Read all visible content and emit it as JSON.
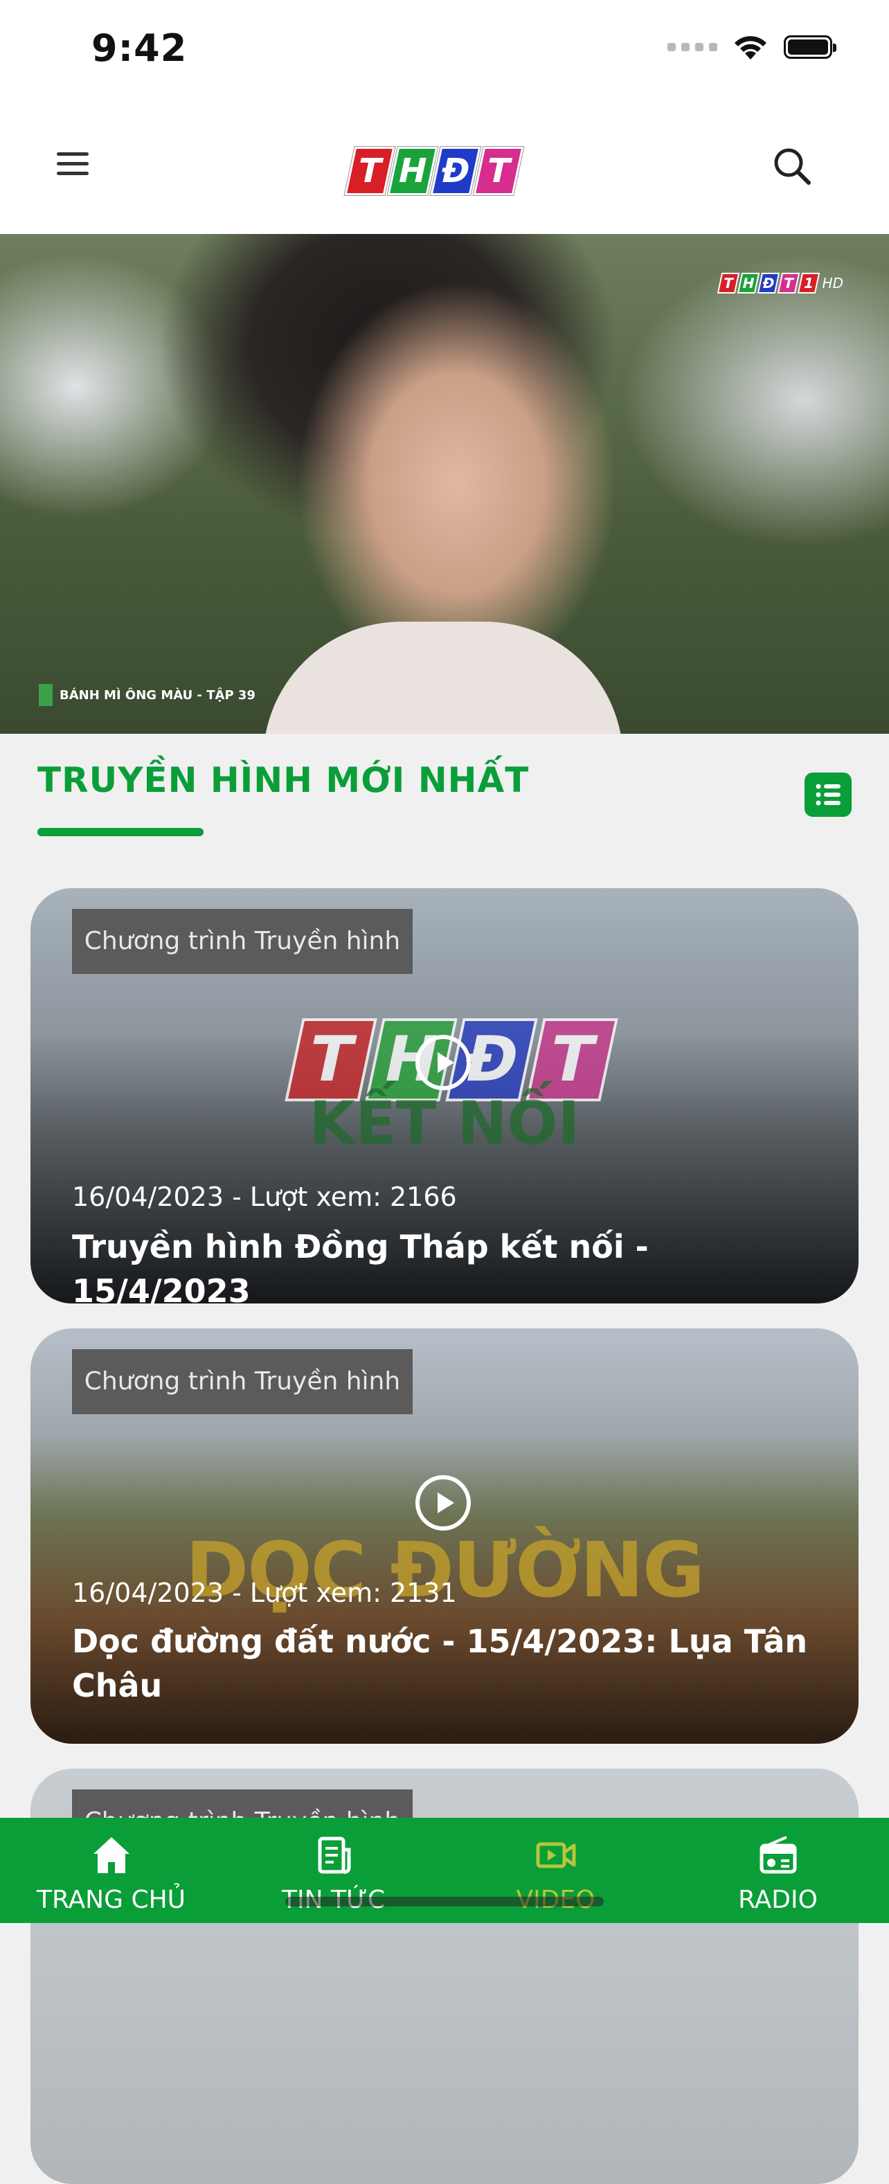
{
  "status_bar": {
    "time": "9:42"
  },
  "header": {
    "logo_letters": [
      {
        "char": "T",
        "color": "#d81f26"
      },
      {
        "char": "H",
        "color": "#1aa33b"
      },
      {
        "char": "Đ",
        "color": "#1f3bc7"
      },
      {
        "char": "T",
        "color": "#d62d8f"
      }
    ]
  },
  "hero": {
    "badge_letters": [
      "T",
      "H",
      "Đ",
      "T",
      "1"
    ],
    "badge_hd": "HD",
    "caption": "BÁNH MÌ ÔNG MÀU - TẬP 39"
  },
  "section": {
    "title": "TRUYỀN HÌNH MỚI NHẤT"
  },
  "cards": [
    {
      "category": "Chương trình Truyền hình",
      "background_text": "KẾT NỐI",
      "meta": "16/04/2023 - Lượt xem: 2166",
      "title": "Truyền hình Đồng Tháp kết nối - 15/4/2023"
    },
    {
      "category": "Chương trình Truyền hình",
      "background_text": "DỌC ĐƯỜNG",
      "meta": "16/04/2023 - Lượt xem: 2131",
      "title": "Dọc đường đất nước - 15/4/2023: Lụa Tân Châu"
    },
    {
      "category": "Chương trình Truyền hình"
    }
  ],
  "bottom_nav": {
    "items": [
      {
        "label": "TRANG CHỦ",
        "icon": "home-icon"
      },
      {
        "label": "TIN TỨC",
        "icon": "news-icon"
      },
      {
        "label": "VIDEO",
        "icon": "video-icon"
      },
      {
        "label": "RADIO",
        "icon": "radio-icon"
      }
    ]
  },
  "colors": {
    "brand_green": "#0a9e38",
    "video_active": "#b7c63a"
  }
}
